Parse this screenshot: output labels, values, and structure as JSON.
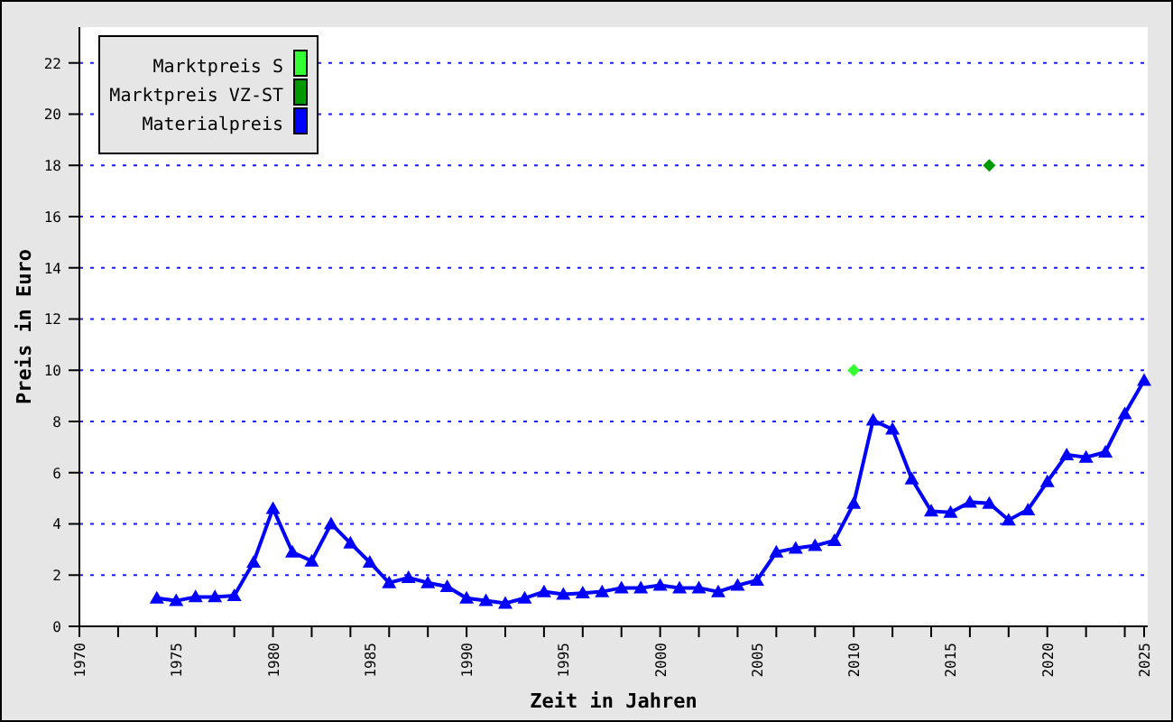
{
  "chart": {
    "chart_data": {
      "type": "line",
      "xlabel": "Zeit in Jahren",
      "ylabel": "Preis in Euro",
      "x": [
        1974,
        1975,
        1976,
        1977,
        1978,
        1979,
        1980,
        1981,
        1982,
        1983,
        1984,
        1985,
        1986,
        1987,
        1988,
        1989,
        1990,
        1991,
        1992,
        1993,
        1994,
        1995,
        1996,
        1997,
        1998,
        1999,
        2000,
        2001,
        2002,
        2003,
        2004,
        2005,
        2006,
        2007,
        2008,
        2009,
        2010,
        2011,
        2012,
        2013,
        2014,
        2015,
        2016,
        2017,
        2018,
        2019,
        2020,
        2021,
        2022,
        2023,
        2024,
        2025
      ],
      "series": [
        {
          "name": "Marktpreis S",
          "color": "#33ff33",
          "marker": "diamond",
          "values": [
            null,
            null,
            null,
            null,
            null,
            null,
            null,
            null,
            null,
            null,
            null,
            null,
            null,
            null,
            null,
            null,
            null,
            null,
            null,
            null,
            null,
            null,
            null,
            null,
            null,
            null,
            null,
            null,
            null,
            null,
            null,
            null,
            null,
            null,
            null,
            null,
            10,
            null,
            null,
            null,
            null,
            null,
            null,
            null,
            null,
            null,
            null,
            null,
            null,
            null,
            null,
            null
          ]
        },
        {
          "name": "Marktpreis VZ-ST",
          "color": "#009900",
          "marker": "diamond",
          "values": [
            null,
            null,
            null,
            null,
            null,
            null,
            null,
            null,
            null,
            null,
            null,
            null,
            null,
            null,
            null,
            null,
            null,
            null,
            null,
            null,
            null,
            null,
            null,
            null,
            null,
            null,
            null,
            null,
            null,
            null,
            null,
            null,
            null,
            null,
            null,
            null,
            null,
            null,
            null,
            null,
            null,
            null,
            null,
            18,
            null,
            null,
            null,
            null,
            null,
            null,
            null,
            null
          ]
        },
        {
          "name": "Materialpreis",
          "color": "#0000ff",
          "marker": "triangle",
          "values": [
            1.1,
            1.0,
            1.15,
            1.15,
            1.2,
            2.5,
            4.6,
            2.9,
            2.55,
            4.0,
            3.25,
            2.5,
            1.7,
            1.9,
            1.7,
            1.55,
            1.1,
            1.0,
            0.9,
            1.1,
            1.35,
            1.25,
            1.3,
            1.35,
            1.5,
            1.5,
            1.6,
            1.5,
            1.5,
            1.35,
            1.6,
            1.8,
            2.9,
            3.05,
            3.15,
            3.35,
            4.8,
            8.05,
            7.7,
            5.75,
            4.5,
            4.45,
            4.85,
            4.8,
            4.15,
            4.55,
            5.65,
            6.7,
            6.6,
            6.8,
            8.3,
            9.6
          ]
        }
      ],
      "xticks": [
        1970,
        1975,
        1980,
        1985,
        1990,
        1995,
        2000,
        2005,
        2010,
        2015,
        2020,
        2025
      ],
      "yticks": [
        0,
        2,
        4,
        6,
        8,
        10,
        12,
        14,
        16,
        18,
        20,
        22
      ],
      "xlim": [
        1970,
        2025
      ],
      "ylim": [
        0,
        23.4
      ],
      "legend": true,
      "grid": "y"
    }
  }
}
